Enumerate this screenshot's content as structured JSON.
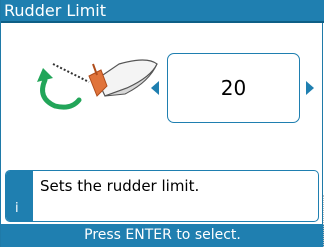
{
  "screen": {
    "title": "Rudder Limit",
    "value": "20",
    "info_icon": "i",
    "info_text": "Sets the rudder limit.",
    "status_text": "Press ENTER to select."
  },
  "icons": {
    "illustration": "boat-rudder-turn-icon",
    "left": "arrow-left-icon",
    "right": "arrow-right-icon",
    "info": "info-icon"
  },
  "colors": {
    "accent": "#1f7fb0",
    "rudder": "#e0733a",
    "turn_arrow": "#22a559"
  }
}
